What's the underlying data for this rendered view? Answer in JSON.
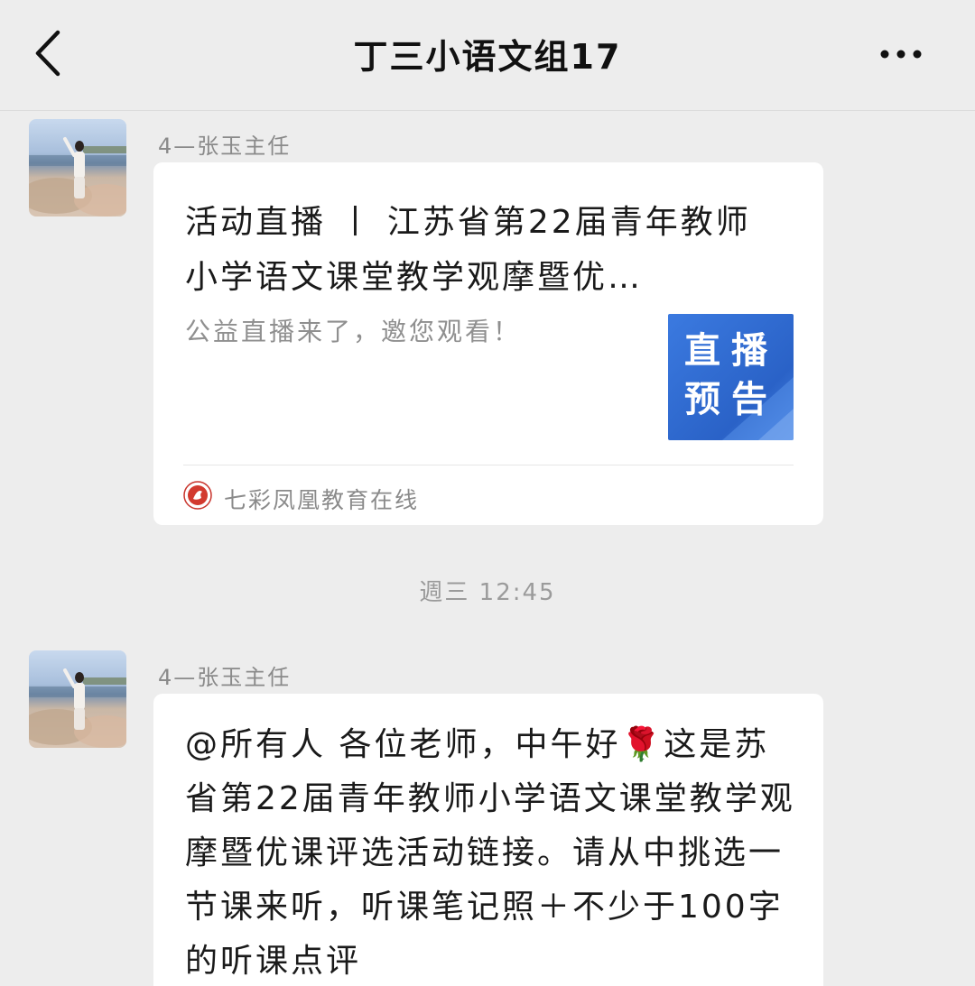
{
  "header": {
    "title": "丁三小语文组17",
    "back_icon": "chevron-left-icon",
    "more_icon": "more-dots-icon"
  },
  "messages": [
    {
      "sender": "4—张玉主任",
      "type": "link-card",
      "card": {
        "title": "活动直播 丨 江苏省第22届青年教师小学语文课堂教学观摩暨优…",
        "description": "公益直播来了，邀您观看！",
        "thumbnail_text": "直播预告",
        "source_name": "七彩凤凰教育在线"
      }
    },
    {
      "sender": "4—张玉主任",
      "type": "text",
      "text": "@所有人  各位老师，中午好🌹这是苏省第22届青年教师小学语文课堂教学观摩暨优课评选活动链接。请从中挑选一节课来听，听课笔记照＋不少于100字的听课点评"
    }
  ],
  "timestamp": "週三 12:45",
  "colors": {
    "background": "#ededed",
    "bubble": "#ffffff",
    "thumbnail_blue": "#2f6fd4"
  }
}
